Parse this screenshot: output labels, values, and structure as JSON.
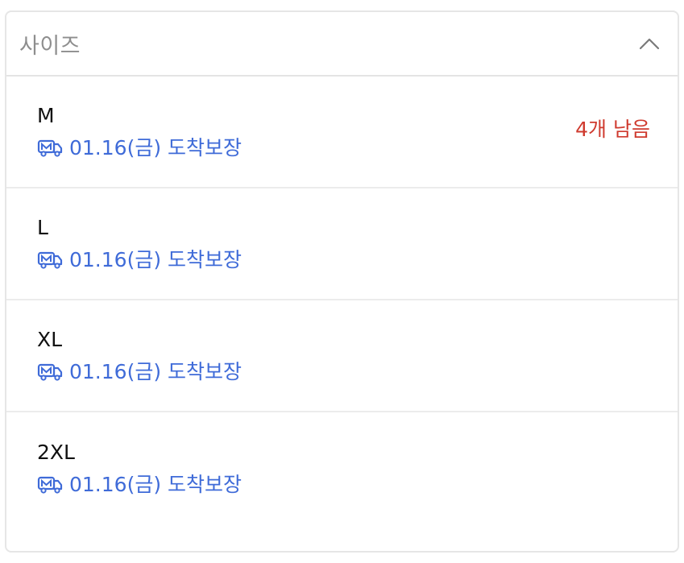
{
  "dropdown": {
    "placeholder": "사이즈",
    "expanded": true,
    "colors": {
      "delivery": "#3f6bd8",
      "stock_warning": "#cf3a2e",
      "border": "#e6e6e6"
    }
  },
  "options": [
    {
      "size": "M",
      "delivery": "01.16(금) 도착보장",
      "stock": "4개 남음"
    },
    {
      "size": "L",
      "delivery": "01.16(금) 도착보장",
      "stock": ""
    },
    {
      "size": "XL",
      "delivery": "01.16(금) 도착보장",
      "stock": ""
    },
    {
      "size": "2XL",
      "delivery": "01.16(금) 도착보장",
      "stock": ""
    }
  ],
  "icons": {
    "header": "chevron-up-icon",
    "delivery": "delivery-truck-icon"
  }
}
